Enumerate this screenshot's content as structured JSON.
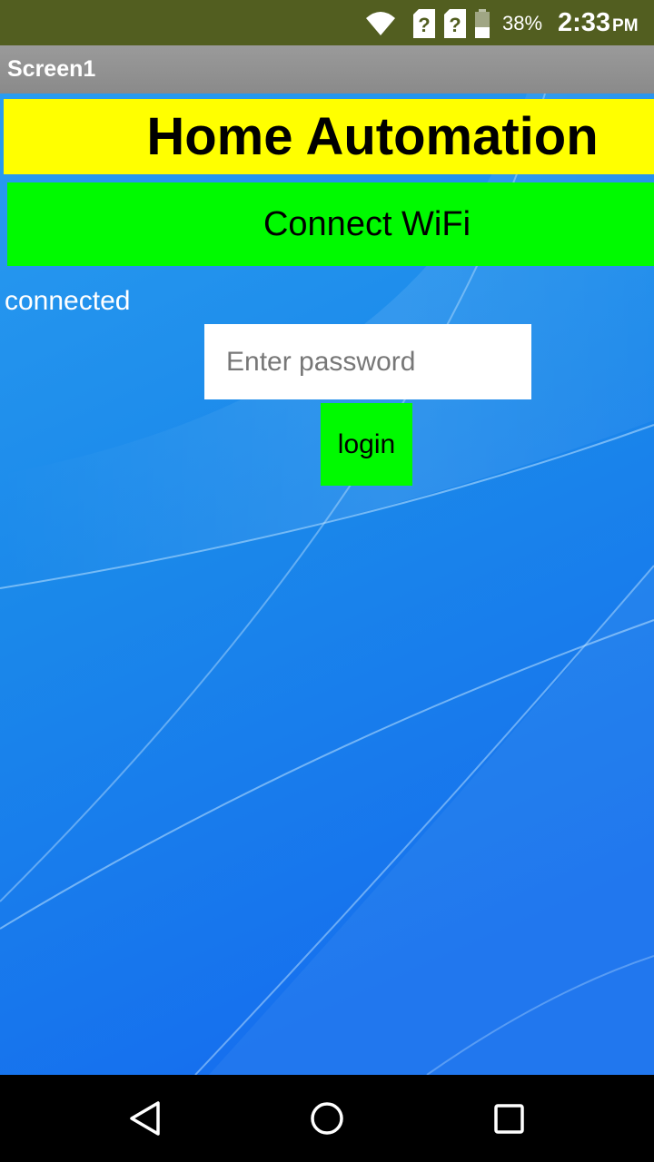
{
  "status_bar": {
    "battery_percent": "38%",
    "time": "2:33",
    "ampm": "PM",
    "icons": [
      "wifi-icon",
      "sim-unknown-icon",
      "sim-unknown-icon",
      "battery-icon"
    ]
  },
  "app_bar": {
    "title": "Screen1"
  },
  "main": {
    "header_text": "Home Automation",
    "connect_button_label": "Connect WiFi",
    "connection_status": "connected",
    "password_placeholder": "Enter password",
    "password_value": "",
    "login_button_label": "login"
  },
  "colors": {
    "status_bar": "#525e20",
    "title_bar": "#8e8e8e",
    "background": "#1b86ea",
    "header_bg": "#ffff00",
    "button_bg": "#00fa00"
  },
  "nav_bar": {
    "icons": [
      "back-icon",
      "home-icon",
      "recent-apps-icon"
    ]
  }
}
